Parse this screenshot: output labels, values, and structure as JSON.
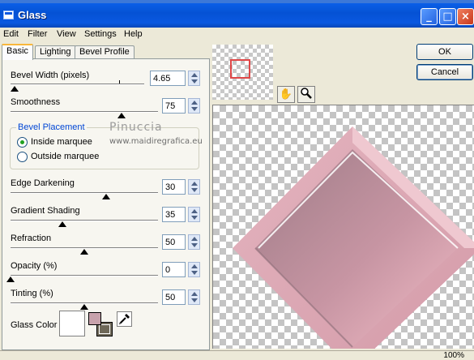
{
  "window": {
    "title": "Glass"
  },
  "menu": [
    "Edit",
    "Filter",
    "View",
    "Settings",
    "Help"
  ],
  "tabs": [
    "Basic",
    "Lighting",
    "Bevel Profile"
  ],
  "basic": {
    "bevel_width": {
      "label": "Bevel Width (pixels)",
      "value": "4.65",
      "level_percent": 3
    },
    "smoothness": {
      "label": "Smoothness",
      "value": "75",
      "level_percent": 75
    },
    "bevel_placement": {
      "title": "Bevel Placement",
      "options": [
        "Inside marquee",
        "Outside marquee"
      ],
      "selected": "Inside marquee"
    },
    "edge_darkening": {
      "label": "Edge Darkening",
      "value": "30",
      "level_percent": 65
    },
    "gradient_shading": {
      "label": "Gradient Shading",
      "value": "35",
      "level_percent": 35
    },
    "refraction": {
      "label": "Refraction",
      "value": "50",
      "level_percent": 50
    },
    "opacity": {
      "label": "Opacity (%)",
      "value": "0",
      "level_percent": 0
    },
    "tinting": {
      "label": "Tinting (%)",
      "value": "50",
      "level_percent": 50
    },
    "glass_color": {
      "label": "Glass Color",
      "swatch": "#ffffff",
      "foreground": "#c8a2ac",
      "background": "#6e6858"
    }
  },
  "watermark": {
    "name": "Pinuccia",
    "site": "www.maidiregrafica.eu"
  },
  "buttons": {
    "ok": "OK",
    "cancel": "Cancel"
  },
  "status": {
    "zoom": "100%"
  },
  "icons": [
    "pan-hand-icon",
    "zoom-magnifier-icon",
    "eyedropper-icon",
    "minimize-icon",
    "maximize-icon",
    "close-icon"
  ],
  "colors": {
    "titlebar": "#0a58e0",
    "panel": "#ece9d8",
    "glass_tile_light": "#f2bcc6",
    "glass_tile_dark": "#9e7c87"
  }
}
